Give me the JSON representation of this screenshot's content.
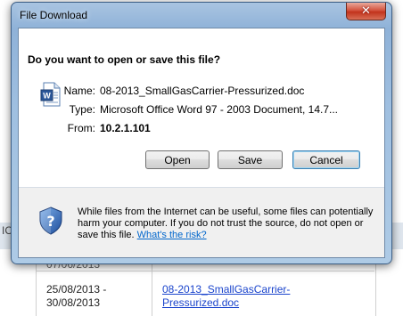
{
  "background": {
    "side_label": "IC",
    "row1_date": "07/06/2013",
    "row2_date": "25/08/2013 -\n30/08/2013",
    "row2_link": "08-2013_SmallGasCarrier-\nPressurized.doc"
  },
  "dialog": {
    "title": "File Download",
    "close_glyph": "✕",
    "question": "Do you want to open or save this file?",
    "file": {
      "name_label": "Name:",
      "name_value": "08-2013_SmallGasCarrier-Pressurized.doc",
      "type_label": "Type:",
      "type_value": "Microsoft Office Word 97 - 2003 Document, 14.7...",
      "from_label": "From:",
      "from_value": "10.2.1.101"
    },
    "buttons": {
      "open": "Open",
      "save": "Save",
      "cancel": "Cancel"
    },
    "warning": {
      "text": "While files from the Internet can be useful, some files can potentially harm your computer. If you do not trust the source, do not open or save this file.",
      "link": "What's the risk?"
    }
  },
  "colors": {
    "link": "#0066cc",
    "close_button": "#c2331c",
    "frame": "#9fbfe0"
  }
}
